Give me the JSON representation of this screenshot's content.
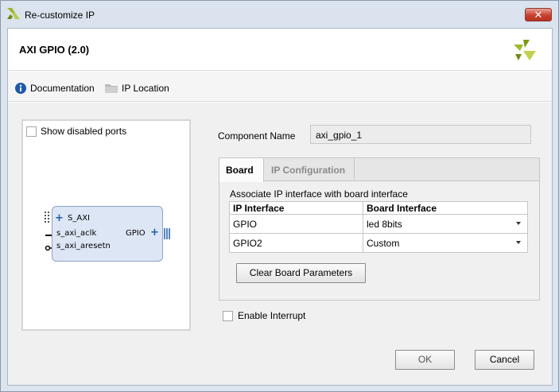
{
  "window": {
    "title": "Re-customize IP",
    "close_glyph": "✕"
  },
  "header": {
    "title": "AXI GPIO (2.0)",
    "logo_icon": "xilinx-logo-icon"
  },
  "links": {
    "documentation": "Documentation",
    "ip_location": "IP Location"
  },
  "preview": {
    "show_disabled_ports": "Show disabled ports",
    "ports": {
      "s_axi": "S_AXI",
      "aclk": "s_axi_aclk",
      "aresetn": "s_axi_aresetn",
      "gpio": "GPIO"
    },
    "plus": "+"
  },
  "component": {
    "label": "Component Name",
    "value": "axi_gpio_1"
  },
  "tabs": {
    "board": "Board",
    "ip_config": "IP Configuration"
  },
  "board": {
    "assoc_text": "Associate IP interface with board interface",
    "headers": {
      "ip_interface": "IP Interface",
      "board_interface": "Board Interface"
    },
    "rows": [
      {
        "ip": "GPIO",
        "board": "led 8bits"
      },
      {
        "ip": "GPIO2",
        "board": "Custom"
      }
    ],
    "clear_button": "Clear Board Parameters"
  },
  "enable_interrupt": "Enable Interrupt",
  "buttons": {
    "ok": "OK",
    "cancel": "Cancel"
  },
  "colors": {
    "accent_green": "#8fae1b",
    "block_fill": "#dde6f5",
    "info_blue": "#1e5aa8"
  }
}
